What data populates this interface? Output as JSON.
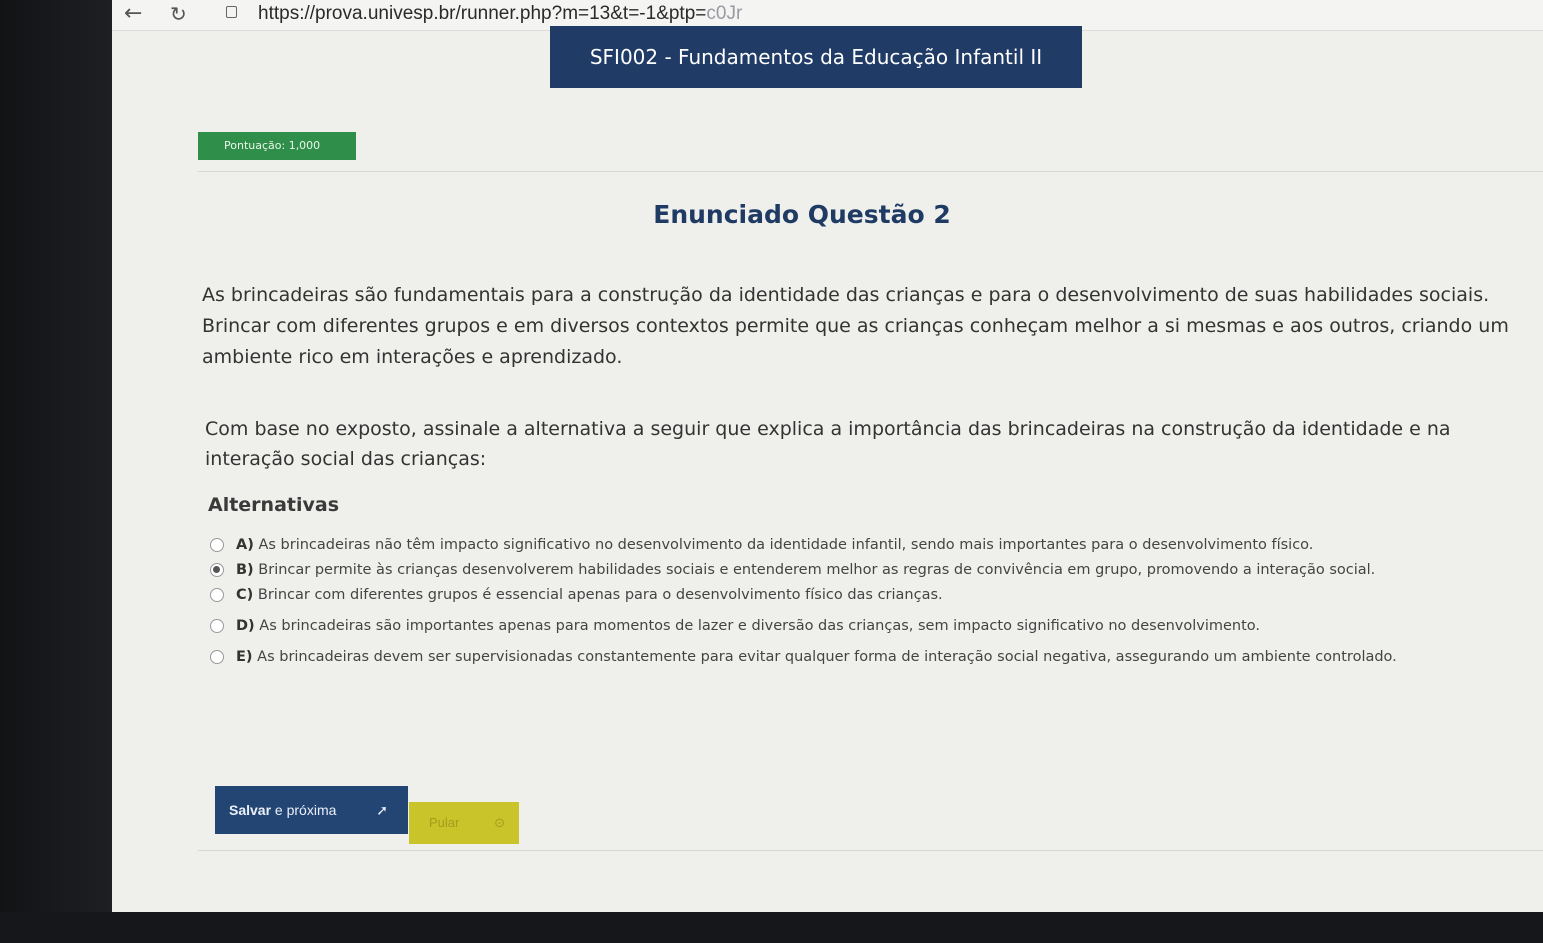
{
  "browser": {
    "url": "https://prova.univesp.br/runner.php?m=13&t=-1&ptp=",
    "url_faded": "c0Jr"
  },
  "header": {
    "course_title": "SFI002 - Fundamentos da Educação Infantil II"
  },
  "score": {
    "label": "Pontuação: 1,000"
  },
  "question": {
    "title": "Enunciado Questão 2",
    "statement": "As brincadeiras são fundamentais para a construção da identidade das crianças e para o desenvolvimento de suas habilidades sociais. Brincar com diferentes grupos e em diversos contextos permite que as crianças conheçam melhor a si mesmas e aos outros, criando um ambiente rico em interações e aprendizado.",
    "prompt": "Com base no exposto, assinale a alternativa a seguir que explica a importância das brincadeiras na construção da identidade e na interação social das crianças:"
  },
  "alternatives": {
    "heading": "Alternativas",
    "items": [
      {
        "letter": "A)",
        "text": "As brincadeiras não têm impacto significativo no desenvolvimento da identidade infantil, sendo mais importantes para o desenvolvimento físico.",
        "selected": false
      },
      {
        "letter": "B)",
        "text": "Brincar permite às crianças desenvolverem habilidades sociais e entenderem melhor as regras de convivência em grupo, promovendo a interação social.",
        "selected": true
      },
      {
        "letter": "C)",
        "text": "Brincar com diferentes grupos é essencial apenas para o desenvolvimento físico das crianças.",
        "selected": false
      },
      {
        "letter": "D)",
        "text": "As brincadeiras são importantes apenas para momentos de lazer e diversão das crianças, sem impacto significativo no desenvolvimento.",
        "selected": false
      },
      {
        "letter": "E)",
        "text": "As brincadeiras devem ser supervisionadas constantemente para evitar qualquer forma de interação social negativa, assegurando um ambiente controlado.",
        "selected": false
      }
    ]
  },
  "actions": {
    "save_strong": "Salvar",
    "save_rest": " e próxima",
    "skip_label": "Pular"
  },
  "colors": {
    "header_bg": "#1f3b66",
    "score_bg": "#2f8f4a",
    "save_bg": "#234574",
    "skip_bg": "#c8c42a"
  }
}
